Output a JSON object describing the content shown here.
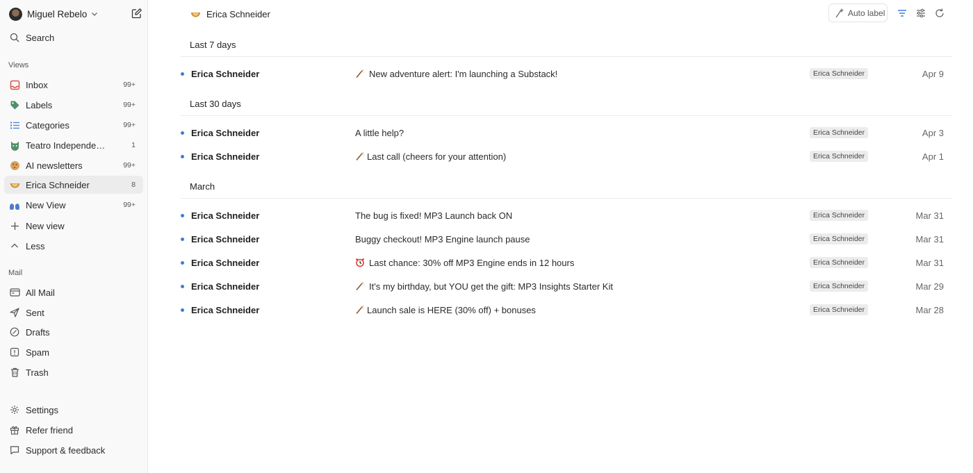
{
  "user": {
    "name": "Miguel Rebelo"
  },
  "sidebar": {
    "search_label": "Search",
    "views_title": "Views",
    "views": [
      {
        "label": "Inbox",
        "count": "99+",
        "icon": "inbox-icon"
      },
      {
        "label": "Labels",
        "count": "99+",
        "icon": "tag-icon"
      },
      {
        "label": "Categories",
        "count": "99+",
        "icon": "list-icon"
      },
      {
        "label": "Teatro Independent...",
        "count": "1",
        "icon": "cat-mask-icon"
      },
      {
        "label": "AI newsletters",
        "count": "99+",
        "icon": "cookie-icon"
      },
      {
        "label": "Erica Schneider",
        "count": "8",
        "icon": "bowl-icon"
      },
      {
        "label": "New View",
        "count": "99+",
        "icon": "lungs-icon"
      }
    ],
    "new_view_label": "New view",
    "less_label": "Less",
    "mail_title": "Mail",
    "mail": [
      {
        "label": "All Mail",
        "icon": "all-mail-icon"
      },
      {
        "label": "Sent",
        "icon": "send-icon"
      },
      {
        "label": "Drafts",
        "icon": "draft-icon"
      },
      {
        "label": "Spam",
        "icon": "spam-icon"
      },
      {
        "label": "Trash",
        "icon": "trash-icon"
      }
    ],
    "footer": [
      {
        "label": "Settings",
        "icon": "gear-icon"
      },
      {
        "label": "Refer friend",
        "icon": "gift-icon"
      },
      {
        "label": "Support & feedback",
        "icon": "chat-icon"
      }
    ]
  },
  "header": {
    "title": "Erica Schneider",
    "auto_label": "Auto label"
  },
  "groups": {
    "last7": "Last 7 days",
    "last30": "Last 30 days",
    "march": "March"
  },
  "emails": [
    {
      "sender": "Erica Schneider",
      "emoji": "wand",
      "subject": "New adventure alert: I'm launching a Substack!",
      "tag": "Erica Schneider",
      "date": "Apr 9"
    },
    {
      "sender": "Erica Schneider",
      "emoji": "",
      "subject": "A little help?",
      "tag": "Erica Schneider",
      "date": "Apr 3"
    },
    {
      "sender": "Erica Schneider",
      "emoji": "wand",
      "subject": "Last call (cheers for your attention)",
      "tag": "Erica Schneider",
      "date": "Apr 1"
    },
    {
      "sender": "Erica Schneider",
      "emoji": "",
      "subject": "The bug is fixed! MP3 Launch back ON",
      "tag": "Erica Schneider",
      "date": "Mar 31"
    },
    {
      "sender": "Erica Schneider",
      "emoji": "",
      "subject": "Buggy checkout! MP3 Engine launch pause",
      "tag": "Erica Schneider",
      "date": "Mar 31"
    },
    {
      "sender": "Erica Schneider",
      "emoji": "alarm",
      "subject": "Last chance: 30% off MP3 Engine ends in 12 hours",
      "tag": "Erica Schneider",
      "date": "Mar 31"
    },
    {
      "sender": "Erica Schneider",
      "emoji": "wand",
      "subject": "It's my birthday, but YOU get the gift: MP3 Insights Starter Kit",
      "tag": "Erica Schneider",
      "date": "Mar 29"
    },
    {
      "sender": "Erica Schneider",
      "emoji": "wand",
      "subject": "Launch sale is HERE (30% off) + bonuses",
      "tag": "Erica Schneider",
      "date": "Mar 28"
    }
  ],
  "colors": {
    "accent": "#3b7ddd",
    "unread_dot": "#3b7ddd"
  }
}
